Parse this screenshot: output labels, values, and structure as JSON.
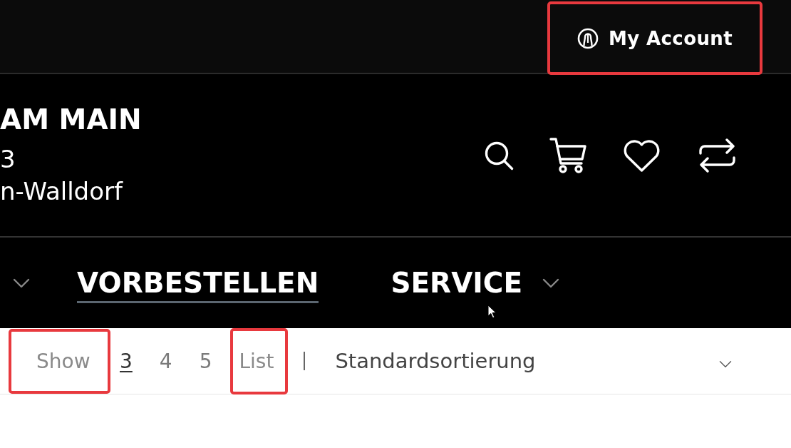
{
  "top_bar": {
    "account_button": {
      "label": "My Account",
      "highlighted": true
    }
  },
  "store": {
    "name": "AM MAIN",
    "address_lines": [
      "3",
      "n-Walldorf"
    ]
  },
  "nav": {
    "items": [
      {
        "has_dropdown": true,
        "selected": false
      },
      {
        "label": "VORBESTELLEN",
        "has_dropdown": false,
        "selected": true
      },
      {
        "label": "SERVICE",
        "has_dropdown": true,
        "selected": false
      }
    ]
  },
  "toolbar": {
    "show_label": {
      "text": "Show",
      "highlighted": true
    },
    "columns": [
      {
        "label": "3",
        "selected": true
      },
      {
        "label": "4",
        "selected": false
      },
      {
        "label": "5",
        "selected": false
      }
    ],
    "list_toggle": {
      "label": "List",
      "highlighted": true
    },
    "sort": {
      "value": "Standardsortierung"
    }
  }
}
